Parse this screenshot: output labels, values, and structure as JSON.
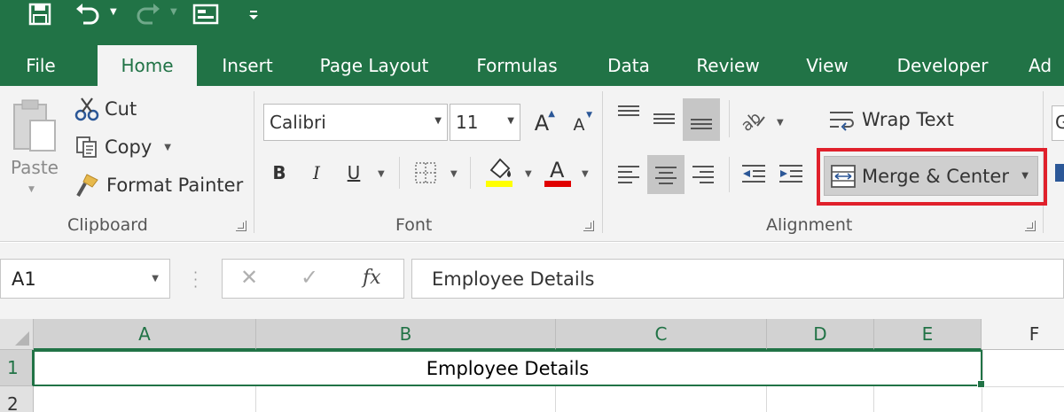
{
  "quick_access": {
    "icons": [
      "save-icon",
      "undo-icon",
      "redo-icon",
      "form-icon",
      "customize-icon"
    ]
  },
  "tabs": [
    {
      "label": "File"
    },
    {
      "label": "Home"
    },
    {
      "label": "Insert"
    },
    {
      "label": "Page Layout"
    },
    {
      "label": "Formulas"
    },
    {
      "label": "Data"
    },
    {
      "label": "Review"
    },
    {
      "label": "View"
    },
    {
      "label": "Developer"
    },
    {
      "label": "Ad"
    }
  ],
  "active_tab": "Home",
  "clipboard": {
    "paste_label": "Paste",
    "cut_label": "Cut",
    "copy_label": "Copy",
    "format_painter_label": "Format Painter",
    "group_label": "Clipboard"
  },
  "font": {
    "font_name": "Calibri",
    "font_size": "11",
    "bold": "B",
    "italic": "I",
    "underline": "U",
    "group_label": "Font",
    "highlight_color": "#ffff00",
    "font_color": "#e00000"
  },
  "alignment": {
    "wrap_text_label": "Wrap Text",
    "merge_center_label": "Merge & Center",
    "group_label": "Alignment",
    "highlight_box_color": "#e0202b"
  },
  "formula_bar": {
    "name_box": "A1",
    "fx_label": "fx",
    "formula": "Employee Details"
  },
  "grid": {
    "columns": [
      "A",
      "B",
      "C",
      "D",
      "E",
      "F"
    ],
    "rows": [
      "1",
      "2"
    ],
    "merged_cell_text": "Employee Details"
  },
  "colors": {
    "brand": "#217346",
    "ribbon_bg": "#f3f3f3"
  }
}
